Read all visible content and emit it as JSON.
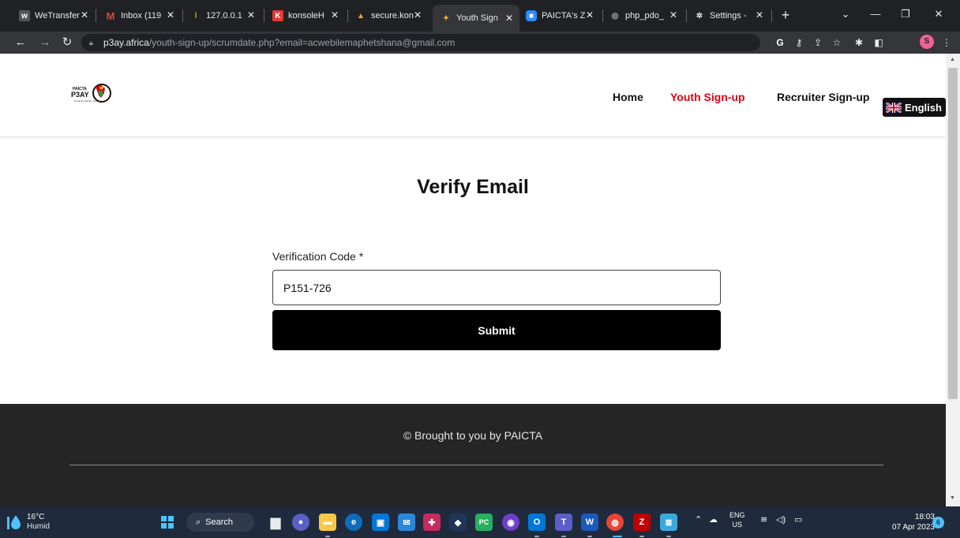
{
  "browser": {
    "tabs": [
      {
        "label": "WeTransfer",
        "icon": "wetransfer-icon"
      },
      {
        "label": "Inbox (119",
        "icon": "gmail-icon"
      },
      {
        "label": "127.0.0.1",
        "icon": "localhost-icon"
      },
      {
        "label": "konsoleH",
        "icon": "konsoleh-icon"
      },
      {
        "label": "secure.kon",
        "icon": "secure-icon"
      },
      {
        "label": "Youth Sign",
        "icon": "paicta-icon"
      },
      {
        "label": "PAICTA's Z",
        "icon": "zoom-icon"
      },
      {
        "label": "php_pdo_",
        "icon": "globe-icon"
      },
      {
        "label": "Settings -",
        "icon": "settings-icon"
      }
    ],
    "address_host": "p3ay.africa",
    "address_path": "/youth-sign-up/scrumdate.php?email=acwebilemaphetshana@gmail.com",
    "profile_initial": "S"
  },
  "site": {
    "logo_text": "P3AY",
    "nav": {
      "home": "Home",
      "youth_signup": "Youth Sign-up",
      "recruiter_signup": "Recruiter Sign-up"
    },
    "language": "English",
    "accent_color": "#e3000f"
  },
  "form": {
    "title": "Verify Email",
    "code_label": "Verification Code *",
    "code_value": "P151-726",
    "submit_label": "Submit"
  },
  "footer": {
    "text": "© Brought to you by PAICTA"
  },
  "taskbar": {
    "temperature": "16°C",
    "weather": "Humid",
    "search_label": "Search",
    "lang_top": "ENG",
    "lang_bottom": "US",
    "time": "18:03",
    "date": "07 Apr 2023",
    "notifications": "6"
  }
}
